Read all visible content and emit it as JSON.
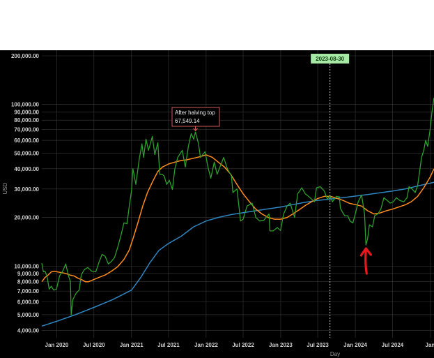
{
  "chart_data": {
    "type": "line",
    "xlabel": "Day",
    "ylabel": "USD",
    "y_scale": "log",
    "ylim": [
      3600,
      200000
    ],
    "xlim": [
      "2019-10-20",
      "2025-01-20"
    ],
    "grid": true,
    "background_color": "#000000",
    "y_ticks": [
      {
        "value": 4000,
        "label": "4,000.00"
      },
      {
        "value": 5000,
        "label": "5,000.00"
      },
      {
        "value": 6000,
        "label": "6,000.00"
      },
      {
        "value": 7000,
        "label": "7,000.00"
      },
      {
        "value": 8000,
        "label": "8,000.00"
      },
      {
        "value": 9000,
        "label": "9,000.00"
      },
      {
        "value": 10000,
        "label": "10,000.00"
      },
      {
        "value": 20000,
        "label": "20,000.00"
      },
      {
        "value": 30000,
        "label": "30,000.00"
      },
      {
        "value": 40000,
        "label": "40,000.00"
      },
      {
        "value": 50000,
        "label": "50,000.00"
      },
      {
        "value": 60000,
        "label": "60,000.00"
      },
      {
        "value": 70000,
        "label": "70,000.00"
      },
      {
        "value": 80000,
        "label": "80,000.00"
      },
      {
        "value": 90000,
        "label": "90,000.00"
      },
      {
        "value": 100000,
        "label": "100,000.00"
      },
      {
        "value": 200000,
        "label": "200,000.00"
      }
    ],
    "x_ticks": [
      {
        "date": "2020-01-01",
        "label": "Jan 2020"
      },
      {
        "date": "2020-07-01",
        "label": "Jul 2020"
      },
      {
        "date": "2021-01-01",
        "label": "Jan 2021"
      },
      {
        "date": "2021-07-01",
        "label": "Jul 2021"
      },
      {
        "date": "2022-01-01",
        "label": "Jan 2022"
      },
      {
        "date": "2022-07-01",
        "label": "Jul 2022"
      },
      {
        "date": "2023-01-01",
        "label": "Jan 2023"
      },
      {
        "date": "2023-07-01",
        "label": "Jul 2023"
      },
      {
        "date": "2024-01-01",
        "label": "Jan 2024"
      },
      {
        "date": "2024-07-01",
        "label": "Jul 2024"
      },
      {
        "date": "2025-01-01",
        "label": "Jan"
      }
    ],
    "series": [
      {
        "color": "#2ca02c",
        "points": [
          [
            "2019-10-20",
            10400
          ],
          [
            "2019-10-28",
            9200
          ],
          [
            "2019-11-05",
            9300
          ],
          [
            "2019-11-15",
            8600
          ],
          [
            "2019-11-25",
            7200
          ],
          [
            "2019-12-05",
            7500
          ],
          [
            "2019-12-18",
            7100
          ],
          [
            "2019-12-31",
            7200
          ],
          [
            "2020-01-15",
            8700
          ],
          [
            "2020-02-01",
            9400
          ],
          [
            "2020-02-14",
            10300
          ],
          [
            "2020-02-28",
            8700
          ],
          [
            "2020-03-08",
            8000
          ],
          [
            "2020-03-12",
            5000
          ],
          [
            "2020-03-20",
            6200
          ],
          [
            "2020-04-05",
            6800
          ],
          [
            "2020-04-20",
            7100
          ],
          [
            "2020-04-30",
            8800
          ],
          [
            "2020-05-15",
            9500
          ],
          [
            "2020-06-01",
            9800
          ],
          [
            "2020-06-20",
            9300
          ],
          [
            "2020-07-10",
            9200
          ],
          [
            "2020-07-25",
            10500
          ],
          [
            "2020-08-10",
            11800
          ],
          [
            "2020-08-25",
            11500
          ],
          [
            "2020-09-10",
            10300
          ],
          [
            "2020-09-25",
            10700
          ],
          [
            "2020-10-10",
            11300
          ],
          [
            "2020-10-25",
            13000
          ],
          [
            "2020-11-10",
            15400
          ],
          [
            "2020-11-25",
            18500
          ],
          [
            "2020-12-10",
            18300
          ],
          [
            "2020-12-20",
            23000
          ],
          [
            "2021-01-01",
            29400
          ],
          [
            "2021-01-08",
            40000
          ],
          [
            "2021-01-22",
            32000
          ],
          [
            "2021-02-08",
            46000
          ],
          [
            "2021-02-21",
            57000
          ],
          [
            "2021-03-01",
            47000
          ],
          [
            "2021-03-13",
            61000
          ],
          [
            "2021-03-25",
            52000
          ],
          [
            "2021-04-13",
            63500
          ],
          [
            "2021-04-25",
            49000
          ],
          [
            "2021-05-10",
            58000
          ],
          [
            "2021-05-19",
            37000
          ],
          [
            "2021-05-31",
            37000
          ],
          [
            "2021-06-10",
            36000
          ],
          [
            "2021-06-22",
            32000
          ],
          [
            "2021-07-05",
            34000
          ],
          [
            "2021-07-20",
            29800
          ],
          [
            "2021-08-01",
            40000
          ],
          [
            "2021-08-15",
            47000
          ],
          [
            "2021-09-06",
            52000
          ],
          [
            "2021-09-21",
            41000
          ],
          [
            "2021-10-06",
            55000
          ],
          [
            "2021-10-20",
            66000
          ],
          [
            "2021-11-01",
            61000
          ],
          [
            "2021-11-10",
            67549
          ],
          [
            "2021-11-25",
            57000
          ],
          [
            "2021-12-04",
            47000
          ],
          [
            "2021-12-27",
            51000
          ],
          [
            "2022-01-10",
            41000
          ],
          [
            "2022-01-24",
            35000
          ],
          [
            "2022-02-10",
            44000
          ],
          [
            "2022-02-24",
            37000
          ],
          [
            "2022-03-28",
            47000
          ],
          [
            "2022-04-15",
            40000
          ],
          [
            "2022-05-05",
            36000
          ],
          [
            "2022-05-12",
            28500
          ],
          [
            "2022-06-01",
            30000
          ],
          [
            "2022-06-13",
            22000
          ],
          [
            "2022-06-18",
            19000
          ],
          [
            "2022-07-01",
            19500
          ],
          [
            "2022-07-20",
            23500
          ],
          [
            "2022-08-14",
            24500
          ],
          [
            "2022-09-01",
            20000
          ],
          [
            "2022-09-20",
            19000
          ],
          [
            "2022-10-10",
            19200
          ],
          [
            "2022-11-05",
            21000
          ],
          [
            "2022-11-09",
            16500
          ],
          [
            "2022-11-25",
            16500
          ],
          [
            "2022-12-15",
            17300
          ],
          [
            "2022-12-31",
            16600
          ],
          [
            "2023-01-15",
            21000
          ],
          [
            "2023-02-01",
            23500
          ],
          [
            "2023-02-16",
            24500
          ],
          [
            "2023-03-10",
            20000
          ],
          [
            "2023-03-25",
            28000
          ],
          [
            "2023-04-14",
            30500
          ],
          [
            "2023-05-01",
            28000
          ],
          [
            "2023-05-25",
            26500
          ],
          [
            "2023-06-15",
            25000
          ],
          [
            "2023-06-25",
            30500
          ],
          [
            "2023-07-13",
            31000
          ],
          [
            "2023-08-01",
            29300
          ],
          [
            "2023-08-17",
            26000
          ],
          [
            "2023-08-30",
            27200
          ],
          [
            "2023-09-11",
            25000
          ],
          [
            "2023-09-30",
            27000
          ],
          [
            "2023-10-15",
            26800
          ],
          [
            "2023-10-20",
            22800
          ],
          [
            "2023-10-28",
            21800
          ],
          [
            "2023-11-10",
            20500
          ],
          [
            "2023-11-25",
            20500
          ],
          [
            "2023-12-06",
            19000
          ],
          [
            "2023-12-20",
            18500
          ],
          [
            "2024-01-01",
            21000
          ],
          [
            "2024-01-15",
            25000
          ],
          [
            "2024-02-01",
            27500
          ],
          [
            "2024-02-15",
            21000
          ],
          [
            "2024-02-22",
            13500
          ],
          [
            "2024-03-01",
            14800
          ],
          [
            "2024-03-10",
            18000
          ],
          [
            "2024-03-25",
            17500
          ],
          [
            "2024-04-05",
            20500
          ],
          [
            "2024-04-20",
            21000
          ],
          [
            "2024-05-05",
            22500
          ],
          [
            "2024-05-20",
            26500
          ],
          [
            "2024-06-05",
            25500
          ],
          [
            "2024-06-20",
            24500
          ],
          [
            "2024-07-05",
            25000
          ],
          [
            "2024-07-20",
            26500
          ],
          [
            "2024-08-05",
            25500
          ],
          [
            "2024-08-25",
            25000
          ],
          [
            "2024-09-10",
            26500
          ],
          [
            "2024-09-20",
            31000
          ],
          [
            "2024-10-05",
            30000
          ],
          [
            "2024-10-20",
            28500
          ],
          [
            "2024-11-01",
            31500
          ],
          [
            "2024-11-10",
            38000
          ],
          [
            "2024-11-20",
            47000
          ],
          [
            "2024-12-01",
            52000
          ],
          [
            "2024-12-10",
            60000
          ],
          [
            "2024-12-20",
            55000
          ],
          [
            "2025-01-01",
            70000
          ],
          [
            "2025-01-10",
            90000
          ],
          [
            "2025-01-20",
            110000
          ]
        ]
      },
      {
        "color": "#ff8c1a",
        "points": [
          [
            "2019-10-20",
            8000
          ],
          [
            "2019-11-05",
            8500
          ],
          [
            "2019-11-20",
            8800
          ],
          [
            "2019-12-05",
            9200
          ],
          [
            "2019-12-20",
            9300
          ],
          [
            "2020-01-05",
            9200
          ],
          [
            "2020-01-25",
            9100
          ],
          [
            "2020-02-15",
            9000
          ],
          [
            "2020-03-05",
            8800
          ],
          [
            "2020-03-25",
            8700
          ],
          [
            "2020-04-15",
            8400
          ],
          [
            "2020-05-05",
            8200
          ],
          [
            "2020-05-20",
            8000
          ],
          [
            "2020-06-05",
            8000
          ],
          [
            "2020-06-25",
            8200
          ],
          [
            "2020-07-25",
            8500
          ],
          [
            "2020-08-25",
            8800
          ],
          [
            "2020-09-25",
            9300
          ],
          [
            "2020-10-25",
            9900
          ],
          [
            "2020-11-25",
            11000
          ],
          [
            "2020-12-20",
            12500
          ],
          [
            "2021-01-10",
            15000
          ],
          [
            "2021-02-01",
            18500
          ],
          [
            "2021-02-25",
            23500
          ],
          [
            "2021-03-20",
            28500
          ],
          [
            "2021-04-15",
            33500
          ],
          [
            "2021-05-10",
            38500
          ],
          [
            "2021-06-01",
            41000
          ],
          [
            "2021-07-01",
            42800
          ],
          [
            "2021-08-01",
            44000
          ],
          [
            "2021-09-01",
            45000
          ],
          [
            "2021-10-01",
            45500
          ],
          [
            "2021-11-01",
            46500
          ],
          [
            "2021-12-01",
            47500
          ],
          [
            "2022-01-01",
            48800
          ],
          [
            "2022-02-01",
            47000
          ],
          [
            "2022-03-01",
            44000
          ],
          [
            "2022-04-01",
            41000
          ],
          [
            "2022-05-01",
            37000
          ],
          [
            "2022-06-01",
            32000
          ],
          [
            "2022-07-01",
            28000
          ],
          [
            "2022-08-01",
            25000
          ],
          [
            "2022-09-01",
            22500
          ],
          [
            "2022-10-01",
            21000
          ],
          [
            "2022-11-01",
            20000
          ],
          [
            "2022-12-01",
            19500
          ],
          [
            "2023-01-01",
            19500
          ],
          [
            "2023-02-01",
            20000
          ],
          [
            "2023-03-01",
            21000
          ],
          [
            "2023-04-01",
            22300
          ],
          [
            "2023-05-01",
            23700
          ],
          [
            "2023-06-01",
            25000
          ],
          [
            "2023-07-01",
            26200
          ],
          [
            "2023-08-01",
            27000
          ],
          [
            "2023-09-01",
            27000
          ],
          [
            "2023-10-01",
            26300
          ],
          [
            "2023-11-01",
            25500
          ],
          [
            "2023-12-01",
            24500
          ],
          [
            "2024-01-01",
            24000
          ],
          [
            "2024-02-01",
            23500
          ],
          [
            "2024-03-01",
            22000
          ],
          [
            "2024-04-01",
            21000
          ],
          [
            "2024-05-01",
            21300
          ],
          [
            "2024-06-01",
            22000
          ],
          [
            "2024-07-01",
            22500
          ],
          [
            "2024-08-01",
            23200
          ],
          [
            "2024-09-01",
            23900
          ],
          [
            "2024-10-01",
            25000
          ],
          [
            "2024-11-01",
            27000
          ],
          [
            "2024-12-01",
            30500
          ],
          [
            "2025-01-01",
            35500
          ],
          [
            "2025-01-20",
            40000
          ]
        ]
      },
      {
        "color": "#2e86c1",
        "points": [
          [
            "2019-10-20",
            4250
          ],
          [
            "2020-01-01",
            4550
          ],
          [
            "2020-04-01",
            5000
          ],
          [
            "2020-07-01",
            5550
          ],
          [
            "2020-10-01",
            6200
          ],
          [
            "2021-01-01",
            7100
          ],
          [
            "2021-02-15",
            8500
          ],
          [
            "2021-04-01",
            10500
          ],
          [
            "2021-05-15",
            12500
          ],
          [
            "2021-07-01",
            13800
          ],
          [
            "2021-09-01",
            15300
          ],
          [
            "2021-11-01",
            17500
          ],
          [
            "2022-01-01",
            19000
          ],
          [
            "2022-03-01",
            20000
          ],
          [
            "2022-05-01",
            20800
          ],
          [
            "2022-07-01",
            21400
          ],
          [
            "2022-09-01",
            22000
          ],
          [
            "2022-11-01",
            22600
          ],
          [
            "2023-01-01",
            23200
          ],
          [
            "2023-03-01",
            24000
          ],
          [
            "2023-05-01",
            24800
          ],
          [
            "2023-07-01",
            25500
          ],
          [
            "2023-09-01",
            26000
          ],
          [
            "2023-11-01",
            26500
          ],
          [
            "2024-01-01",
            27100
          ],
          [
            "2024-03-01",
            27700
          ],
          [
            "2024-05-01",
            28400
          ],
          [
            "2024-07-01",
            29100
          ],
          [
            "2024-09-01",
            30000
          ],
          [
            "2024-11-01",
            31300
          ],
          [
            "2025-01-20",
            33000
          ]
        ]
      }
    ],
    "vertical_marker": {
      "date": "2023-08-30",
      "label": "2023-08-30",
      "label_bg": "#a6e8a6",
      "label_color": "#0f3d0f"
    },
    "annotation": {
      "date": "2021-11-10",
      "value": 67549.14,
      "title": "After halving top",
      "value_text": "67,549.14",
      "border_color": "#d45a5a",
      "text_color": "#eeeeee"
    },
    "arrow_marker": {
      "date": "2024-02-22",
      "color": "#e8181e"
    }
  }
}
